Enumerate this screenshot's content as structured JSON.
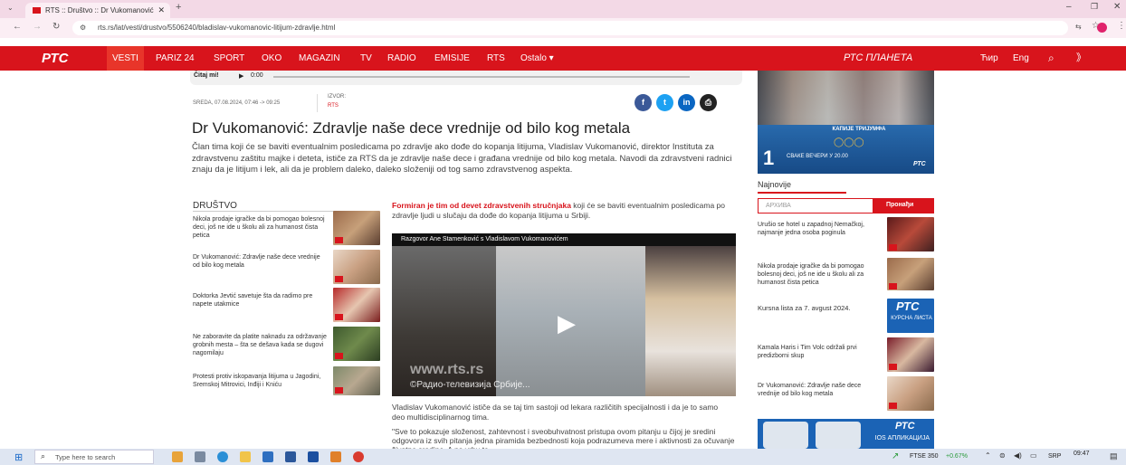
{
  "browser": {
    "tab_title": "RTS :: Društvo :: Dr Vukomanović",
    "url": "rts.rs/lat/vesti/drustvo/5506240/bladislav-vukomanovic-litijum-zdravlje.html"
  },
  "nav": {
    "logo": "РТС",
    "items": [
      "VESTI",
      "PARIZ 24",
      "SPORT",
      "OKO",
      "MAGAZIN",
      "TV",
      "RADIO",
      "EMISIJE",
      "RTS",
      "Ostalo"
    ],
    "planeta": "РТС ПЛАНЕТА",
    "cyr": "Ћир",
    "eng": "Eng"
  },
  "audio": {
    "label": "Čitaj mi!",
    "time": "0:00"
  },
  "article": {
    "date": "SREDA, 07.08.2024, 07:46 -> 09:25",
    "source_label": "IZVOR:",
    "source": "RTS",
    "title": "Dr Vukomanović: Zdravlje naše dece vrednije od bilo kog metala",
    "lead": "Član tima koji će se baviti eventualnim posledicama po zdravlje ako dođe do kopanja litijuma, Vladislav Vukomanović, direktor Instituta za zdravstvenu zaštitu majke i deteta, ističe za RTS da je zdravlje naše dece i građana vrednije od bilo kog metala. Navodi da zdravstveni radnici znaju da je litijum i lek, ali da je problem daleko, daleko složeniji od tog samo zdravstvenog aspekta.",
    "p1_link": "Formiran je tim od devet zdravstvenih stručnjaka",
    "p1_rest": " koji će se baviti eventualnim posledicama po zdravlje ljudi u slučaju da dođe do kopanja litijuma u Srbiji.",
    "video_caption": "Razgovor Ane Stamenković s Vladislavom Vukomanovićem",
    "video_watermark": "www.rts.rs",
    "video_copyright": "©Радио-телевизија Србије...",
    "p2": "Vladislav Vukomanović ističe da se taj tim sastoji od lekara različitih specijalnosti i da je to samo deo multidisciplinarnog tima.",
    "p3": "\"Sve to pokazuje složenost, zahtevnost i sveobuhvatnost pristupa ovom pitanju u čijoj je sredini odgovora iz svih pitanja jedna piramida bezbednosti koja podrazumeva mere i aktivnosti za očuvanje životne sredine. A na vrhu te"
  },
  "drustvo": {
    "heading": "DRUŠTVO",
    "items": [
      "Nikola prodaje igračke da bi pomogao bolesnoj deci, još ne ide u školu ali za humanost čista petica",
      "Dr Vukomanović: Zdravlje naše dece vrednije od bilo kog metala",
      "Doktorka Jevtić savetuje šta da radimo pre napete utakmice",
      "Ne zaboravite da platite naknadu za održavanje grobnih mesta – šta se dešava kada se dugovi nagomilaju",
      "Protesti protiv iskopavanja litijuma u Jagodini, Sremskoj Mitrovici, Inđiji i Kniću"
    ]
  },
  "promo": {
    "title": "КАПИЈЕ ТРИЈУМФА",
    "channel": "1",
    "schedule": "СВАКЕ ВЕЧЕРИ У 20.00",
    "brand": "РТС"
  },
  "najnovije": {
    "heading": "Najnovije",
    "search_placeholder": "АРХИВА",
    "search_button": "Пронађи",
    "items": [
      "Urušio se hotel u zapadnoj Nemačkoj, najmanje jedna osoba poginula",
      "Nikola prodaje igračke da bi pomogao bolesnoj deci, još ne ide u školu ali za humanost čista petica",
      "Kursna lista za 7. avgust 2024.",
      "Kamala Haris i Tim Volc održali prvi predizborni skup",
      "Dr Vukomanović: Zdravlje naše dece vrednije od bilo kog metala"
    ],
    "kursna_label": "КУРСНА ЛИСТА",
    "app_brand": "РТС",
    "app_label": "IOS АПЛИКАЦИЈА"
  },
  "taskbar": {
    "search_placeholder": "Type here to search",
    "stock": "FTSE 350",
    "stock_change": "+0.67%",
    "lang": "SRP",
    "time": "09:47"
  },
  "colors": {
    "rts_red": "#d8141c",
    "facebook": "#3b5998",
    "twitter": "#1da1f2",
    "linkedin": "#0a66c2"
  }
}
